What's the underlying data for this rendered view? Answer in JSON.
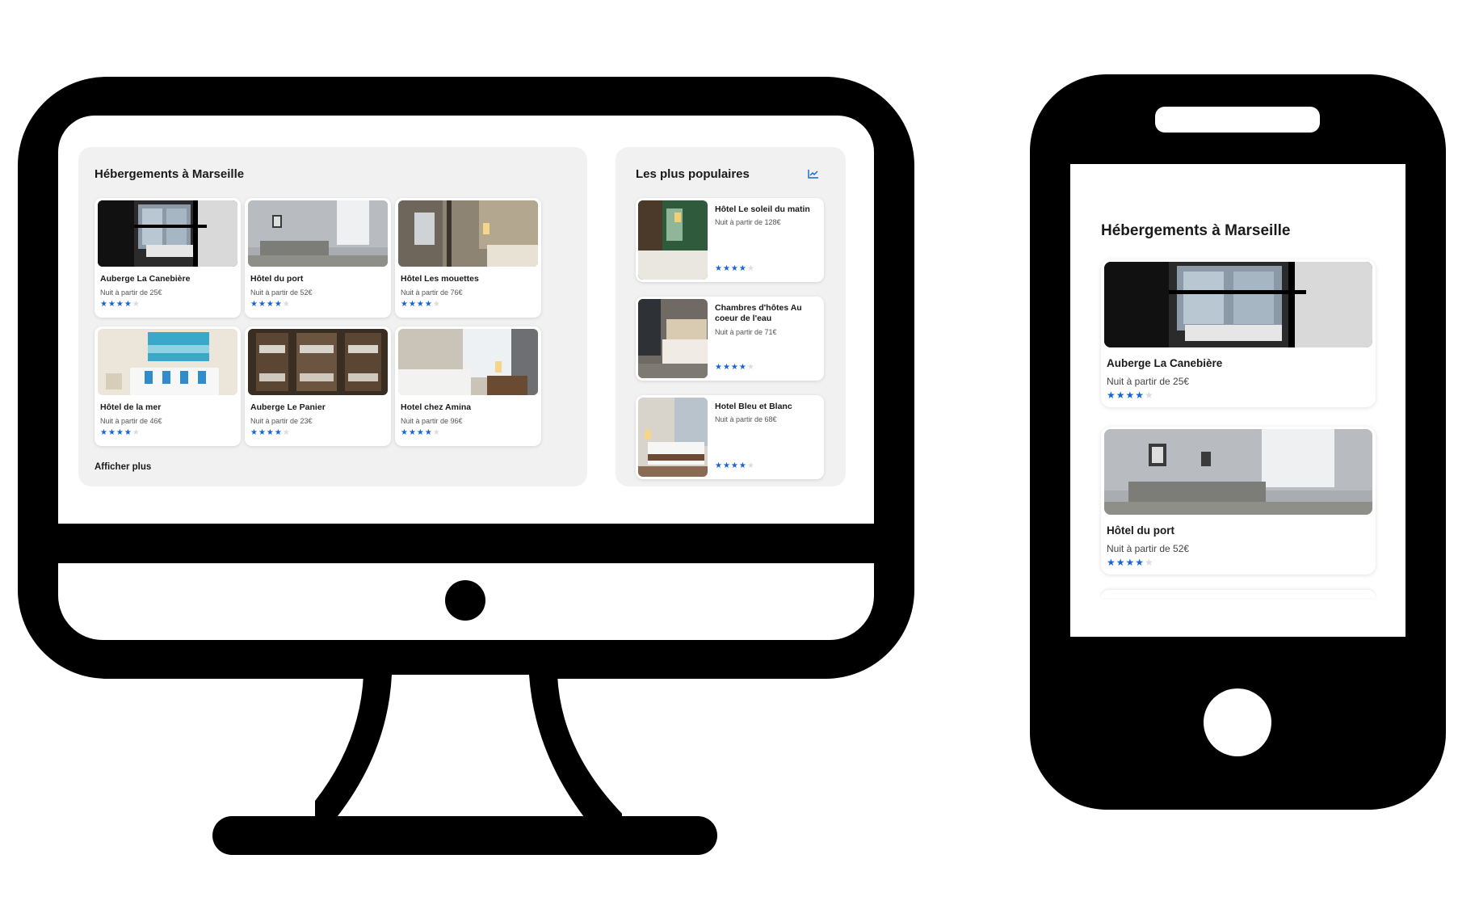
{
  "desktop": {
    "main_title": "Hébergements à Marseille",
    "cards": [
      {
        "name": "Auberge La Canebière",
        "price": "Nuit à partir de 25€",
        "stars": "★★★★",
        "stars_empty": "★"
      },
      {
        "name": "Hôtel du port",
        "price": "Nuit à partir de 52€",
        "stars": "★★★★",
        "stars_empty": "★"
      },
      {
        "name": "Hôtel Les mouettes",
        "price": "Nuit à partir de 76€",
        "stars": "★★★★",
        "stars_empty": "★"
      },
      {
        "name": "Hôtel de la mer",
        "price": "Nuit à partir de 46€",
        "stars": "★★★★",
        "stars_empty": "★"
      },
      {
        "name": "Auberge Le Panier",
        "price": "Nuit à partir de 23€",
        "stars": "★★★★",
        "stars_empty": "★"
      },
      {
        "name": "Hotel chez Amina",
        "price": "Nuit à partir de 96€",
        "stars": "★★★★",
        "stars_empty": "★"
      }
    ],
    "show_more": "Afficher plus",
    "side_title": "Les plus populaires",
    "trend_icon": "chart-line-icon",
    "popular": [
      {
        "name": "Hôtel Le soleil du matin",
        "price": "Nuit à partir de 128€",
        "stars": "★★★★",
        "stars_empty": "★"
      },
      {
        "name": "Chambres d'hôtes Au coeur de l'eau",
        "price": "Nuit à partir de 71€",
        "stars": "★★★★",
        "stars_empty": "★"
      },
      {
        "name": "Hotel Bleu et Blanc",
        "price": "Nuit à partir de 68€",
        "stars": "★★★★",
        "stars_empty": "★"
      }
    ]
  },
  "mobile": {
    "title": "Hébergements à Marseille",
    "cards": [
      {
        "name": "Auberge La Canebière",
        "price": "Nuit à partir de 25€",
        "stars": "★★★★",
        "stars_empty": "★"
      },
      {
        "name": "Hôtel du port",
        "price": "Nuit à partir de 52€",
        "stars": "★★★★",
        "stars_empty": "★"
      }
    ]
  },
  "colors": {
    "star": "#1565d8",
    "panel": "#f1f1f1",
    "device": "#000000"
  }
}
